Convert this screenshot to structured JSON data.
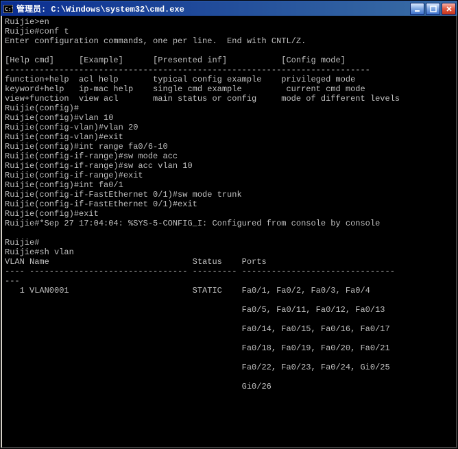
{
  "window": {
    "title": "管理员: C:\\Windows\\system32\\cmd.exe",
    "icon_label": "cmd-icon"
  },
  "terminal_lines": [
    "Ruijie>en",
    "Ruijie#conf t",
    "Enter configuration commands, one per line.  End with CNTL/Z.",
    "",
    "[Help cmd]     [Example]      [Presented inf]           [Config mode]",
    "--------------------------------------------------------------------------",
    "function+help  acl help       typical config example    privileged mode",
    "keyword+help   ip-mac help    single cmd example         current cmd mode",
    "view+function  view acl       main status or config     mode of different levels",
    "Ruijie(config)#",
    "Ruijie(config)#vlan 10",
    "Ruijie(config-vlan)#vlan 20",
    "Ruijie(config-vlan)#exit",
    "Ruijie(config)#int range fa0/6-10",
    "Ruijie(config-if-range)#sw mode acc",
    "Ruijie(config-if-range)#sw acc vlan 10",
    "Ruijie(config-if-range)#exit",
    "Ruijie(config)#int fa0/1",
    "Ruijie(config-if-FastEthernet 0/1)#sw mode trunk",
    "Ruijie(config-if-FastEthernet 0/1)#exit",
    "Ruijie(config)#exit",
    "Ruijie#*Sep 27 17:04:04: %SYS-5-CONFIG_I: Configured from console by console",
    "",
    "Ruijie#",
    "Ruijie#sh vlan",
    "VLAN Name                             Status    Ports",
    "---- -------------------------------- --------- -------------------------------",
    "---",
    "   1 VLAN0001                         STATIC    Fa0/1, Fa0/2, Fa0/3, Fa0/4",
    "",
    "                                                Fa0/5, Fa0/11, Fa0/12, Fa0/13",
    "",
    "                                                Fa0/14, Fa0/15, Fa0/16, Fa0/17",
    "",
    "                                                Fa0/18, Fa0/19, Fa0/20, Fa0/21",
    "",
    "                                                Fa0/22, Fa0/23, Fa0/24, Gi0/25",
    "",
    "                                                Gi0/26"
  ],
  "btn": {
    "min": "—",
    "max": "□",
    "close": "✕"
  }
}
